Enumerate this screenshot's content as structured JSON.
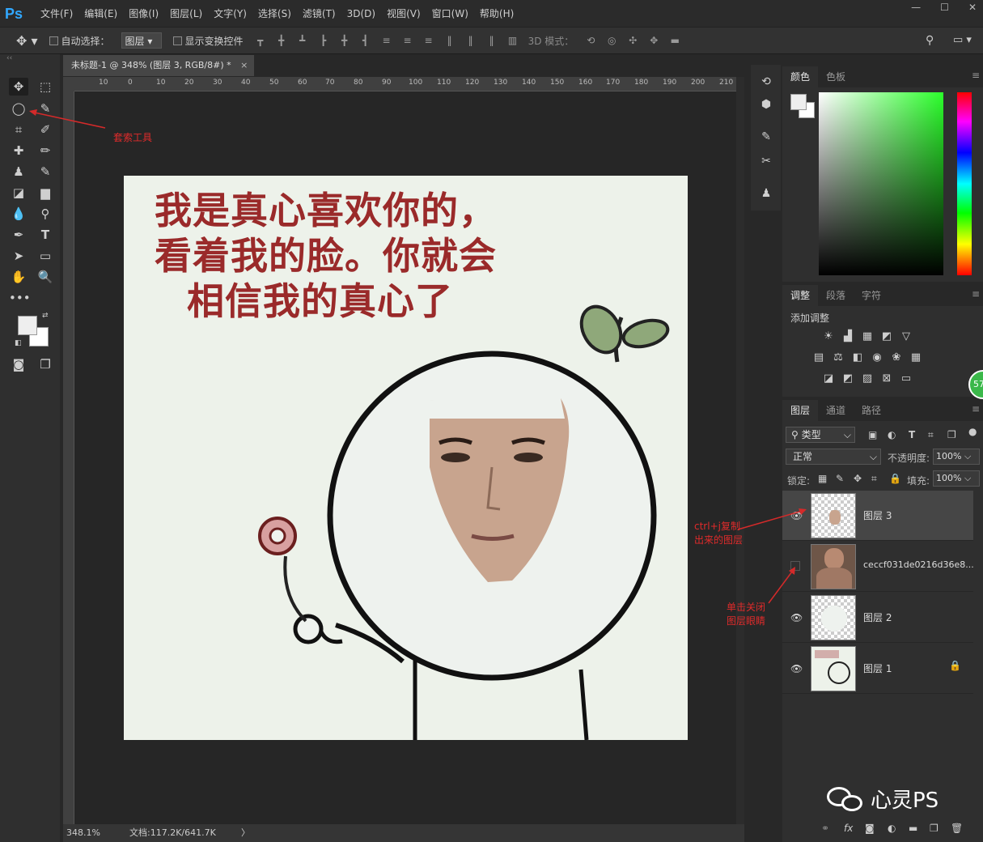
{
  "menu": {
    "logo": "Ps",
    "items": [
      "文件(F)",
      "编辑(E)",
      "图像(I)",
      "图层(L)",
      "文字(Y)",
      "选择(S)",
      "滤镜(T)",
      "3D(D)",
      "视图(V)",
      "窗口(W)",
      "帮助(H)"
    ]
  },
  "options": {
    "auto_select_label": "自动选择：",
    "layer_select_value": "图层",
    "show_transform_label": "显示变换控件",
    "mode3d_label": "3D 模式："
  },
  "document": {
    "tab_title": "未标题-1 @ 348% (图层 3, RGB/8#) *",
    "tab_close": "×",
    "ruler_ticks": [
      "10",
      "0",
      "10",
      "20",
      "30",
      "40",
      "50",
      "60",
      "70",
      "80",
      "90",
      "100",
      "110",
      "120",
      "130",
      "140",
      "150",
      "160",
      "170",
      "180",
      "190",
      "200",
      "210"
    ],
    "canvas_text": [
      "我是真心喜欢你的，",
      "看着我的脸。你就会",
      "相信我的真心了"
    ]
  },
  "status": {
    "zoom": "348.1%",
    "doc_size": "文档:117.2K/641.7K",
    "arrow": "〉"
  },
  "color_panel": {
    "tabs": [
      "颜色",
      "色板"
    ]
  },
  "adjust_panel": {
    "tabs": [
      "调整",
      "段落",
      "字符"
    ],
    "add_label": "添加调整"
  },
  "layers_panel": {
    "tabs": [
      "图层",
      "通道",
      "路径"
    ],
    "filter_label": "类型",
    "blend_mode": "正常",
    "opacity_label": "不透明度:",
    "opacity_value": "100%",
    "lock_label": "锁定:",
    "fill_label": "填充:",
    "fill_value": "100%",
    "layers": [
      {
        "name": "图层 3",
        "visible": true,
        "selected": true
      },
      {
        "name": "ceccf031de0216d36e8...",
        "visible": false,
        "selected": false
      },
      {
        "name": "图层 2",
        "visible": true,
        "selected": false
      },
      {
        "name": "图层 1",
        "visible": true,
        "selected": false,
        "locked": true
      }
    ]
  },
  "annotations": {
    "lasso": "套索工具",
    "ctrl_j_line1": "ctrl+j复制",
    "ctrl_j_line2": "出来的图层",
    "close_eye_line1": "单击关闭",
    "close_eye_line2": "图层眼睛"
  },
  "watermark": "心灵PS",
  "badge": "57"
}
